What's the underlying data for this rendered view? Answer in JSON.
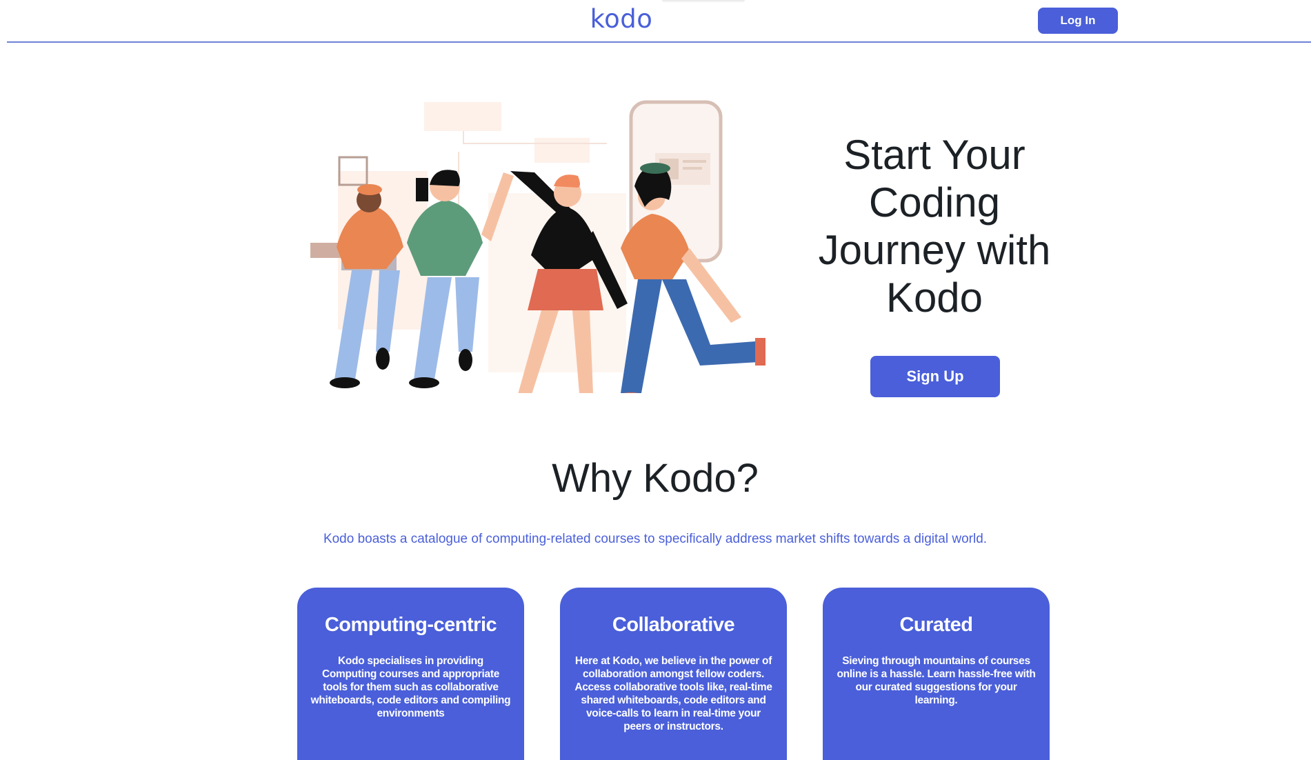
{
  "header": {
    "logo": "kodo",
    "login_label": "Log In"
  },
  "hero": {
    "title": "Start Your Coding Journey with Kodo",
    "signup_label": "Sign Up"
  },
  "why": {
    "title": "Why Kodo?",
    "description": "Kodo boasts a catalogue of computing-related courses to specifically address market shifts towards a digital world."
  },
  "cards": [
    {
      "title": "Computing-centric",
      "text": "Kodo specialises in providing Computing courses and appropriate tools for them such as collaborative whiteboards, code editors and compiling environments"
    },
    {
      "title": "Collaborative",
      "text": "Here at Kodo, we believe in the power of collaboration amongst fellow coders. Access collaborative tools like, real-time shared whiteboards, code editors and voice-calls to learn in real-time your peers or instructors."
    },
    {
      "title": "Curated",
      "text": "Sieving through mountains of courses online is a hassle. Learn hassle-free with our curated suggestions for your learning."
    }
  ],
  "colors": {
    "brand": "#4a5fd9",
    "text": "#1c2126",
    "background": "#ffffff"
  }
}
